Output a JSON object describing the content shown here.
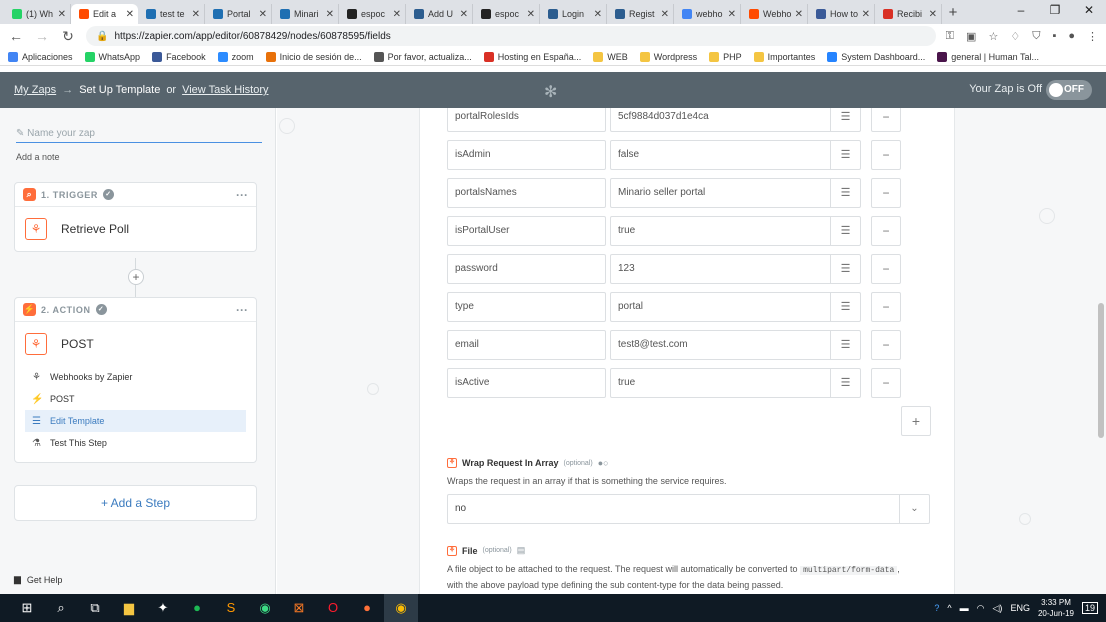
{
  "browser": {
    "tabs": [
      {
        "title": "(1) Wh",
        "icon": "whatsapp-icon",
        "color": "#25d366"
      },
      {
        "title": "Edit a",
        "icon": "zapier-icon",
        "color": "#ff4a00",
        "active": true
      },
      {
        "title": "test te",
        "icon": "e-icon",
        "color": "#1f6fb2"
      },
      {
        "title": "Portal",
        "icon": "e-icon",
        "color": "#1f6fb2"
      },
      {
        "title": "Minari",
        "icon": "e-icon",
        "color": "#1f6fb2"
      },
      {
        "title": "espoc",
        "icon": "github-icon",
        "color": "#222222"
      },
      {
        "title": "Add U",
        "icon": "site-icon",
        "color": "#2c5d8f"
      },
      {
        "title": "espoc",
        "icon": "github-icon",
        "color": "#222222"
      },
      {
        "title": "Login",
        "icon": "site-icon",
        "color": "#2c5d8f"
      },
      {
        "title": "Regist",
        "icon": "site-icon",
        "color": "#2c5d8f"
      },
      {
        "title": "webho",
        "icon": "google-icon",
        "color": "#4285f4"
      },
      {
        "title": "Webho",
        "icon": "zapier-icon",
        "color": "#ff4a00"
      },
      {
        "title": "How to",
        "icon": "site-icon",
        "color": "#3a5a98"
      },
      {
        "title": "Recibi",
        "icon": "gmail-icon",
        "color": "#d93025"
      }
    ],
    "url": "https://zapier.com/app/editor/60878429/nodes/60878595/fields",
    "bookmarks": [
      {
        "label": "Aplicaciones",
        "color": "#4285f4"
      },
      {
        "label": "WhatsApp",
        "color": "#25d366"
      },
      {
        "label": "Facebook",
        "color": "#3b5998"
      },
      {
        "label": "zoom",
        "color": "#2d8cff"
      },
      {
        "label": "Inicio de sesión de...",
        "color": "#e8710a"
      },
      {
        "label": "Por favor, actualiza...",
        "color": "#555555"
      },
      {
        "label": "Hosting en España...",
        "color": "#d93025"
      },
      {
        "label": "WEB",
        "color": "#f4c542"
      },
      {
        "label": "Wordpress",
        "color": "#f4c542"
      },
      {
        "label": "PHP",
        "color": "#f4c542"
      },
      {
        "label": "Importantes",
        "color": "#f4c542"
      },
      {
        "label": "System Dashboard...",
        "color": "#2684ff"
      },
      {
        "label": "general | Human Tal...",
        "color": "#4a154b"
      }
    ]
  },
  "header": {
    "my_zaps": "My Zaps",
    "arrow": "→",
    "current": "Set Up Template",
    "or": "or",
    "history": "View Task History",
    "status": "Your Zap is Off",
    "toggle": "OFF"
  },
  "sidebar": {
    "zap_name_placeholder": "Name your zap",
    "add_note": "Add a note",
    "trigger": {
      "label": "1. TRIGGER",
      "title": "Retrieve Poll"
    },
    "action": {
      "label": "2. ACTION",
      "title": "POST",
      "steps": [
        {
          "label": "Webhooks by Zapier",
          "icon": "webhook-icon"
        },
        {
          "label": "POST",
          "icon": "bolt-icon"
        },
        {
          "label": "Edit Template",
          "icon": "list-icon",
          "selected": true
        },
        {
          "label": "Test This Step",
          "icon": "flask-icon"
        }
      ]
    },
    "add_step": "+ Add a Step",
    "get_help": "Get Help"
  },
  "fields": [
    {
      "key": "portalRolesIds",
      "value": "5cf9884d037d1e4ca"
    },
    {
      "key": "isAdmin",
      "value": "false"
    },
    {
      "key": "portalsNames",
      "value": "Minario seller portal"
    },
    {
      "key": "isPortalUser",
      "value": "true"
    },
    {
      "key": "password",
      "value": "123"
    },
    {
      "key": "type",
      "value": "portal"
    },
    {
      "key": "email",
      "value": "test8@test.com"
    },
    {
      "key": "isActive",
      "value": "true"
    }
  ],
  "wrap": {
    "label": "Wrap Request In Array",
    "optional": "(optional)",
    "help": "Wraps the request in an array if that is something the service requires.",
    "value": "no"
  },
  "file": {
    "label": "File",
    "optional": "(optional)",
    "help_a": "A file object to be attached to the request. The request will automatically be converted to",
    "code": "multipart/form-data",
    "help_b": ",",
    "help_c": "with the above payload type defining the sub content-type for the data being passed."
  },
  "taskbar": {
    "lang": "ENG",
    "time": "3:33 PM",
    "date": "20-Jun-19",
    "notif": "19"
  }
}
